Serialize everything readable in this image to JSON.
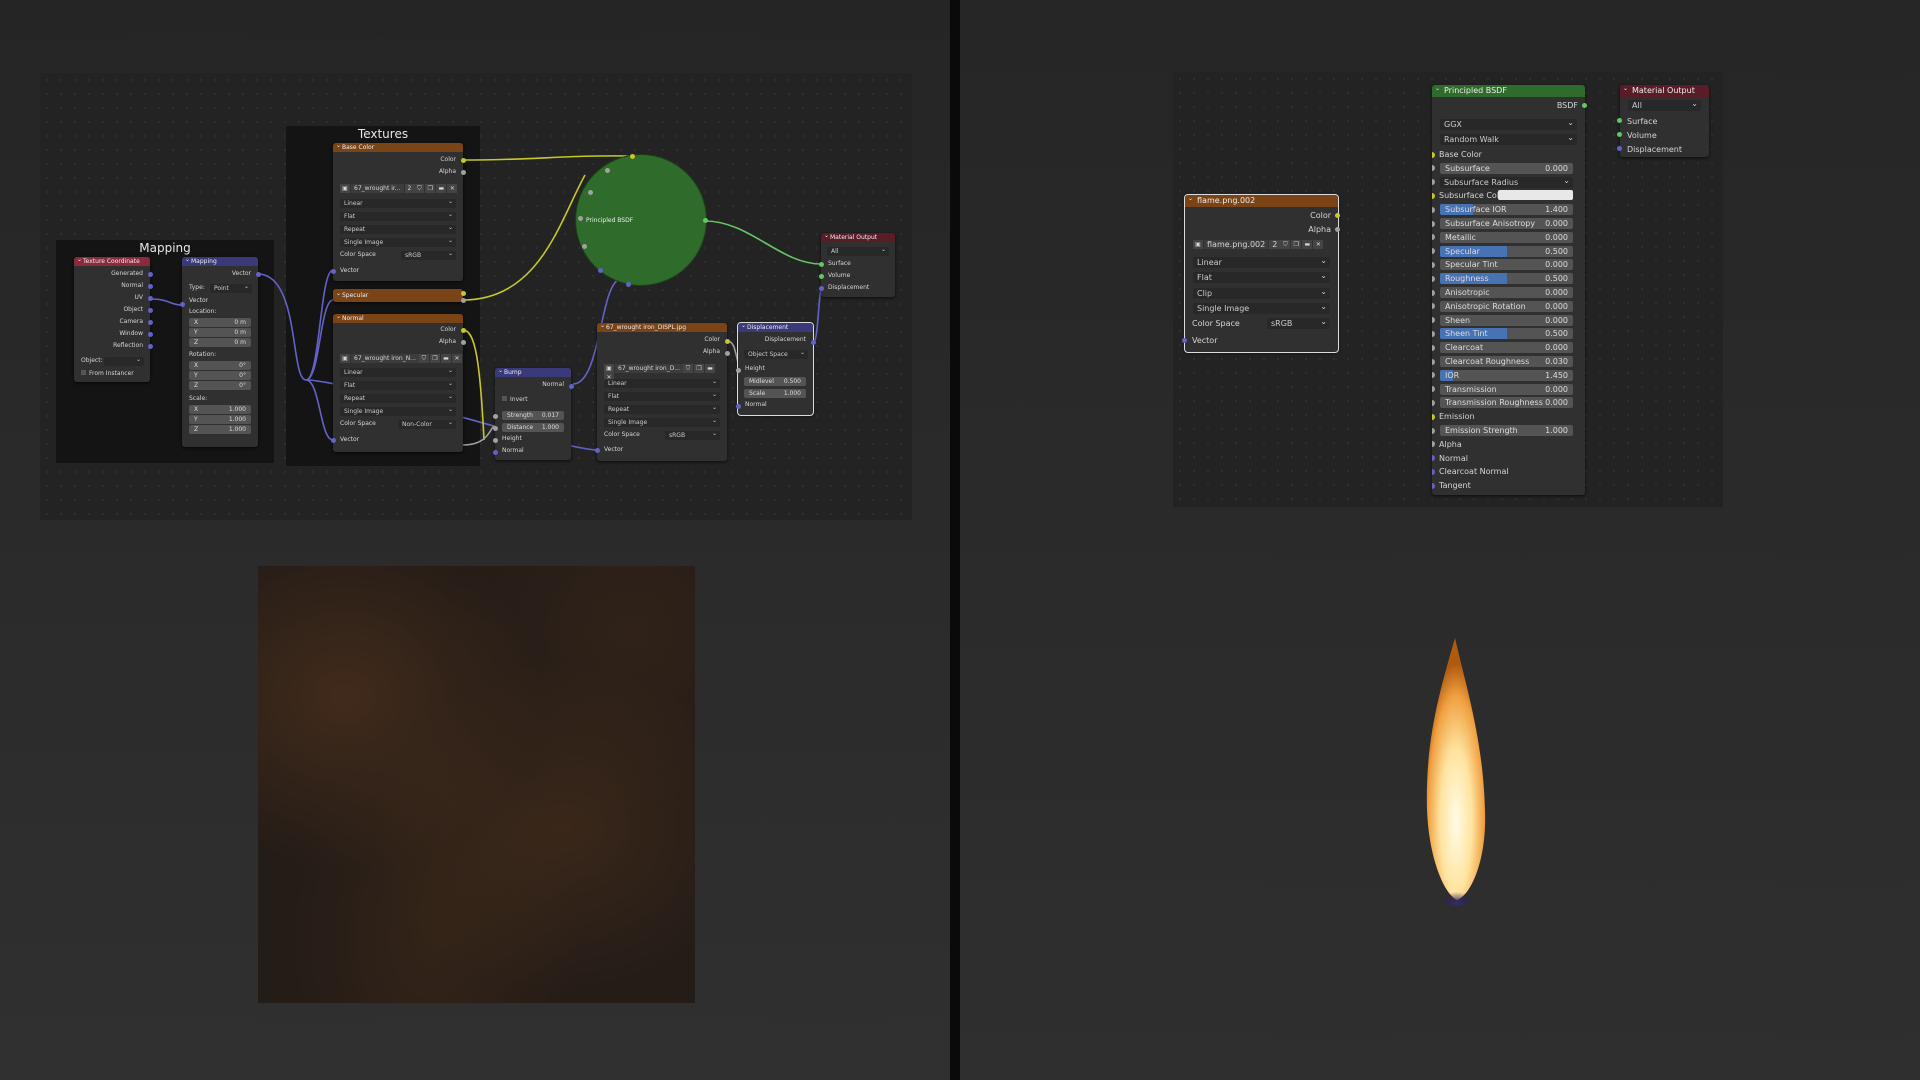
{
  "left": {
    "frames": {
      "mapping_label": "Mapping",
      "textures_label": "Textures"
    },
    "texture_coordinate": {
      "title": "Texture Coordinate",
      "outputs": [
        "Generated",
        "Normal",
        "UV",
        "Object",
        "Camera",
        "Window",
        "Reflection"
      ],
      "object_label": "Object:",
      "from_instancer": "From Instancer"
    },
    "mapping": {
      "title": "Mapping",
      "out_vector": "Vector",
      "type_label": "Type:",
      "type_value": "Point",
      "in_vector": "Vector",
      "location_label": "Location:",
      "location": [
        {
          "axis": "X",
          "value": "0 m"
        },
        {
          "axis": "Y",
          "value": "0 m"
        },
        {
          "axis": "Z",
          "value": "0 m"
        }
      ],
      "rotation_label": "Rotation:",
      "rotation": [
        {
          "axis": "X",
          "value": "0°"
        },
        {
          "axis": "Y",
          "value": "0°"
        },
        {
          "axis": "Z",
          "value": "0°"
        }
      ],
      "scale_label": "Scale:",
      "scale": [
        {
          "axis": "X",
          "value": "1.000"
        },
        {
          "axis": "Y",
          "value": "1.000"
        },
        {
          "axis": "Z",
          "value": "1.000"
        }
      ]
    },
    "base_color": {
      "title": "Base Color",
      "out_color": "Color",
      "out_alpha": "Alpha",
      "image": "67_wrought ir...",
      "users": "2",
      "interp": "Linear",
      "proj": "Flat",
      "ext": "Repeat",
      "source": "Single Image",
      "cs_label": "Color Space",
      "cs_value": "sRGB",
      "in_vector": "Vector"
    },
    "specular": {
      "title": "Specular"
    },
    "normal_tex": {
      "title": "Normal",
      "out_color": "Color",
      "out_alpha": "Alpha",
      "image": "67_wrought iron_N...",
      "interp": "Linear",
      "proj": "Flat",
      "ext": "Repeat",
      "source": "Single Image",
      "cs_label": "Color Space",
      "cs_value": "Non-Color",
      "in_vector": "Vector"
    },
    "bump": {
      "title": "Bump",
      "out_normal": "Normal",
      "invert": "Invert",
      "strength_label": "Strength",
      "strength_value": "0.017",
      "distance_label": "Distance",
      "distance_value": "1.000",
      "in_height": "Height",
      "in_normal": "Normal"
    },
    "disp_tex": {
      "title": "67_wrought iron_DISPL.jpg",
      "out_color": "Color",
      "out_alpha": "Alpha",
      "image": "67_wrought iron_D...",
      "interp": "Linear",
      "proj": "Flat",
      "ext": "Repeat",
      "source": "Single Image",
      "cs_label": "Color Space",
      "cs_value": "sRGB",
      "in_vector": "Vector"
    },
    "displacement": {
      "title": "Displacement",
      "out_disp": "Displacement",
      "space": "Object Space",
      "in_height": "Height",
      "midlevel_label": "Midlevel",
      "midlevel_value": "0.500",
      "scale_label": "Scale",
      "scale_value": "1.000",
      "in_normal": "Normal"
    },
    "principled_collapsed": {
      "title": "Principled BSDF"
    },
    "material_output": {
      "title": "Material Output",
      "target": "All",
      "inputs": [
        "Surface",
        "Volume",
        "Displacement"
      ]
    }
  },
  "right": {
    "image_node": {
      "title": "flame.png.002",
      "out_color": "Color",
      "out_alpha": "Alpha",
      "image": "flame.png.002",
      "users": "2",
      "interp": "Linear",
      "proj": "Flat",
      "ext": "Clip",
      "source": "Single Image",
      "cs_label": "Color Space",
      "cs_value": "sRGB",
      "in_vector": "Vector"
    },
    "principled": {
      "title": "Principled BSDF",
      "out_bsdf": "BSDF",
      "distribution": "GGX",
      "subsurface_method": "Random Walk",
      "rows": [
        {
          "label": "Base Color",
          "kind": "socket"
        },
        {
          "label": "Subsurface",
          "value": "0.000",
          "kind": "field"
        },
        {
          "label": "Subsurface Radius",
          "kind": "dropdown"
        },
        {
          "label": "Subsurface Colo",
          "kind": "color"
        },
        {
          "label": "Subsurface IOR",
          "value": "1.400",
          "kind": "field",
          "fill": 0.25
        },
        {
          "label": "Subsurface Anisotropy",
          "value": "0.000",
          "kind": "field"
        },
        {
          "label": "Metallic",
          "value": "0.000",
          "kind": "field"
        },
        {
          "label": "Specular",
          "value": "0.500",
          "kind": "field",
          "fill": 0.5
        },
        {
          "label": "Specular Tint",
          "value": "0.000",
          "kind": "field"
        },
        {
          "label": "Roughness",
          "value": "0.500",
          "kind": "field",
          "fill": 0.5
        },
        {
          "label": "Anisotropic",
          "value": "0.000",
          "kind": "field"
        },
        {
          "label": "Anisotropic Rotation",
          "value": "0.000",
          "kind": "field"
        },
        {
          "label": "Sheen",
          "value": "0.000",
          "kind": "field"
        },
        {
          "label": "Sheen Tint",
          "value": "0.500",
          "kind": "field",
          "fill": 0.5
        },
        {
          "label": "Clearcoat",
          "value": "0.000",
          "kind": "field"
        },
        {
          "label": "Clearcoat Roughness",
          "value": "0.030",
          "kind": "field"
        },
        {
          "label": "IOR",
          "value": "1.450",
          "kind": "field",
          "fill": 0.1
        },
        {
          "label": "Transmission",
          "value": "0.000",
          "kind": "field"
        },
        {
          "label": "Transmission Roughness",
          "value": "0.000",
          "kind": "field"
        },
        {
          "label": "Emission",
          "kind": "socket"
        },
        {
          "label": "Emission Strength",
          "value": "1.000",
          "kind": "field"
        },
        {
          "label": "Alpha",
          "kind": "socket"
        },
        {
          "label": "Normal",
          "kind": "socket"
        },
        {
          "label": "Clearcoat Normal",
          "kind": "socket"
        },
        {
          "label": "Tangent",
          "kind": "socket"
        }
      ]
    },
    "material_output": {
      "title": "Material Output",
      "target": "All",
      "inputs": [
        "Surface",
        "Volume",
        "Displacement"
      ]
    }
  },
  "colors": {
    "texture_header": "#7a4416",
    "vector_header": "#3a3a7a",
    "input_header": "#8a2a3c",
    "output_header": "#5a1c26",
    "shader_header": "#2f6b2a",
    "wire_color": "#c7c729",
    "wire_float": "#a1a1a1",
    "wire_vector": "#6363c7",
    "wire_shader": "#63c763"
  }
}
